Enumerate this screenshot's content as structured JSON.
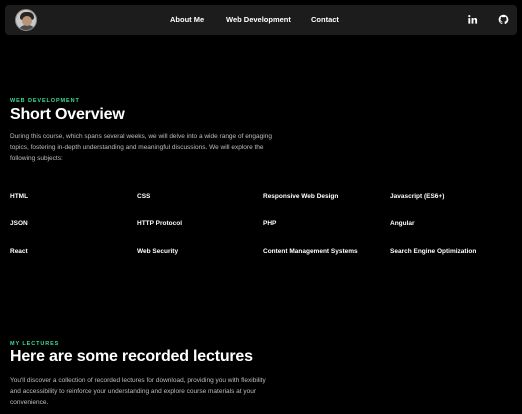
{
  "nav": {
    "links": [
      "About Me",
      "Web Development",
      "Contact"
    ],
    "icons": [
      "linkedin-icon",
      "github-icon"
    ]
  },
  "overview": {
    "eyebrow": "WEB DEVELOPMENT",
    "title": "Short Overview",
    "description": "During this course, which spans several weeks, we will delve into a wide range of engaging topics, fostering in-depth understanding and meaningful discussions. We will explore the following subjects:",
    "topics": [
      "HTML",
      "CSS",
      "Responsive Web Design",
      "Javascript (ES6+)",
      "JSON",
      "HTTP Protocol",
      "PHP",
      "Angular",
      "React",
      "Web Security",
      "Content Management Systems",
      "Search Engine Optimization"
    ]
  },
  "lectures": {
    "eyebrow": "MY LECTURES",
    "title": "Here are some recorded lectures",
    "description": "You'll discover a collection of recorded lectures for download, providing you with flexibility and accessibility to reinforce your understanding and explore course materials at your convenience."
  },
  "colors": {
    "accent": "#3ddc97",
    "background": "#000000",
    "navbar": "#1c1c1c"
  }
}
